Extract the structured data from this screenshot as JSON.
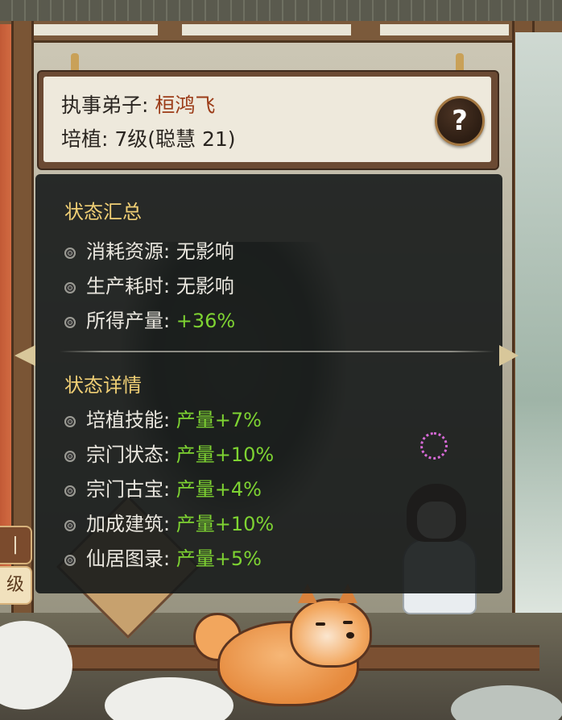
{
  "header": {
    "role_label": "执事弟子:",
    "disciple_name": "桓鸿飞",
    "cultivation_label": "培植:",
    "cultivation_level": "7级",
    "wisdom_text": "(聪慧 21)",
    "help_icon": "question-mark-icon",
    "help_glyph": "?"
  },
  "summary": {
    "title": "状态汇总",
    "rows": [
      {
        "label": "消耗资源:",
        "value": "无影响",
        "tone": "neutral"
      },
      {
        "label": "生产耗时:",
        "value": "无影响",
        "tone": "neutral"
      },
      {
        "label": "所得产量:",
        "value": "+36%",
        "tone": "green"
      }
    ]
  },
  "details": {
    "title": "状态详情",
    "rows": [
      {
        "label": "培植技能:",
        "value": "产量+7%",
        "tone": "green"
      },
      {
        "label": "宗门状态:",
        "value": "产量+10%",
        "tone": "green"
      },
      {
        "label": "宗门古宝:",
        "value": "产量+4%",
        "tone": "green"
      },
      {
        "label": "加成建筑:",
        "value": "产量+10%",
        "tone": "green"
      },
      {
        "label": "仙居图录:",
        "value": "产量+5%",
        "tone": "green"
      }
    ]
  },
  "side_buttons": {
    "upper_glyph": "|",
    "lower_glyph": "级"
  },
  "colors": {
    "title_gold": "#f0cf75",
    "positive_green": "#7ed332",
    "name_red": "#9b3b17"
  }
}
